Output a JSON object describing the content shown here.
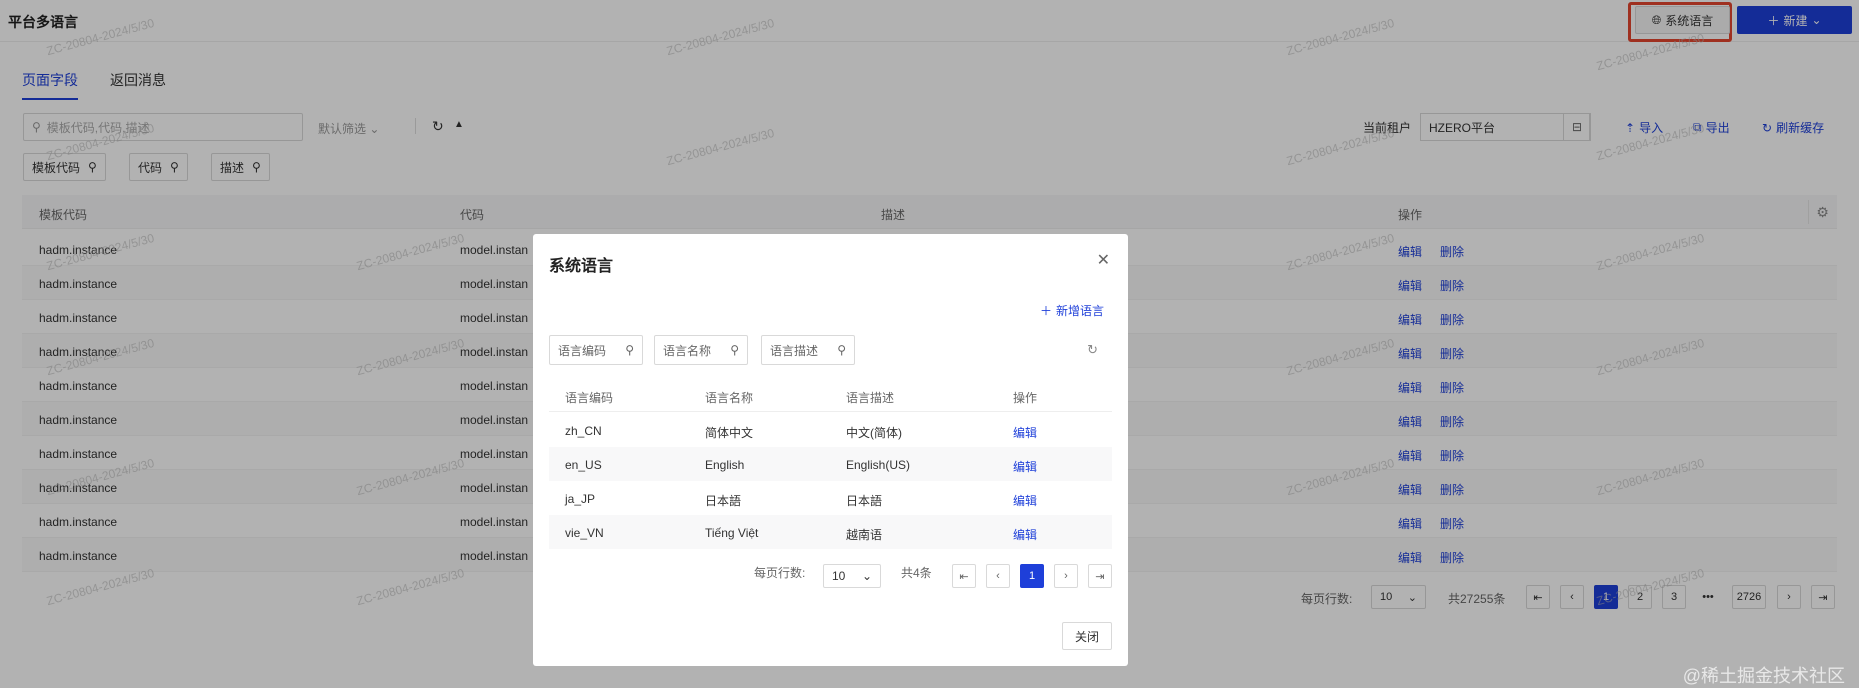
{
  "header": {
    "title": "平台多语言",
    "sys_lang_label": "系统语言",
    "new_label": "新建"
  },
  "tabs": [
    {
      "label": "页面字段",
      "active": true
    },
    {
      "label": "返回消息",
      "active": false
    }
  ],
  "search": {
    "placeholder": "模板代码,代码,描述",
    "filter_label": "默认筛选"
  },
  "filter_chips": [
    "模板代码",
    "代码",
    "描述"
  ],
  "tenant": {
    "label": "当前租户",
    "value": "HZERO平台"
  },
  "toolbar": {
    "import_label": "导入",
    "export_label": "导出",
    "refresh_cache_label": "刷新缓存"
  },
  "table": {
    "headers": [
      "模板代码",
      "代码",
      "描述",
      "操作"
    ],
    "rows": [
      {
        "template": "hadm.instance",
        "code": "model.instan"
      },
      {
        "template": "hadm.instance",
        "code": "model.instan"
      },
      {
        "template": "hadm.instance",
        "code": "model.instan"
      },
      {
        "template": "hadm.instance",
        "code": "model.instan"
      },
      {
        "template": "hadm.instance",
        "code": "model.instan"
      },
      {
        "template": "hadm.instance",
        "code": "model.instan"
      },
      {
        "template": "hadm.instance",
        "code": "model.instan"
      },
      {
        "template": "hadm.instance",
        "code": "model.instan"
      },
      {
        "template": "hadm.instance",
        "code": "model.instan"
      },
      {
        "template": "hadm.instance",
        "code": "model.instan"
      }
    ],
    "edit_label": "编辑",
    "delete_label": "删除"
  },
  "pagination": {
    "per_page_label": "每页行数:",
    "per_page_value": "10",
    "total_label": "共27255条",
    "pages": [
      "1",
      "2",
      "3",
      "•••",
      "2726"
    ],
    "current": "1"
  },
  "watermark": "ZC-20804-2024/5/30",
  "modal": {
    "title": "系统语言",
    "add_label": "新增语言",
    "filters": [
      "语言编码",
      "语言名称",
      "语言描述"
    ],
    "headers": [
      "语言编码",
      "语言名称",
      "语言描述",
      "操作"
    ],
    "rows": [
      {
        "code": "zh_CN",
        "name": "简体中文",
        "desc": "中文(简体)"
      },
      {
        "code": "en_US",
        "name": "English",
        "desc": "English(US)"
      },
      {
        "code": "ja_JP",
        "name": "日本語",
        "desc": "日本語"
      },
      {
        "code": "vie_VN",
        "name": "Tiếng Việt",
        "desc": "越南语"
      }
    ],
    "edit_label": "编辑",
    "per_page_label": "每页行数:",
    "per_page_value": "10",
    "total_label": "共4条",
    "current_page": "1",
    "close_label": "关闭"
  },
  "footer_mark": "@稀土掘金技术社区",
  "colors": {
    "primary": "#1e3fd9",
    "highlight_outline": "#e4462e"
  }
}
